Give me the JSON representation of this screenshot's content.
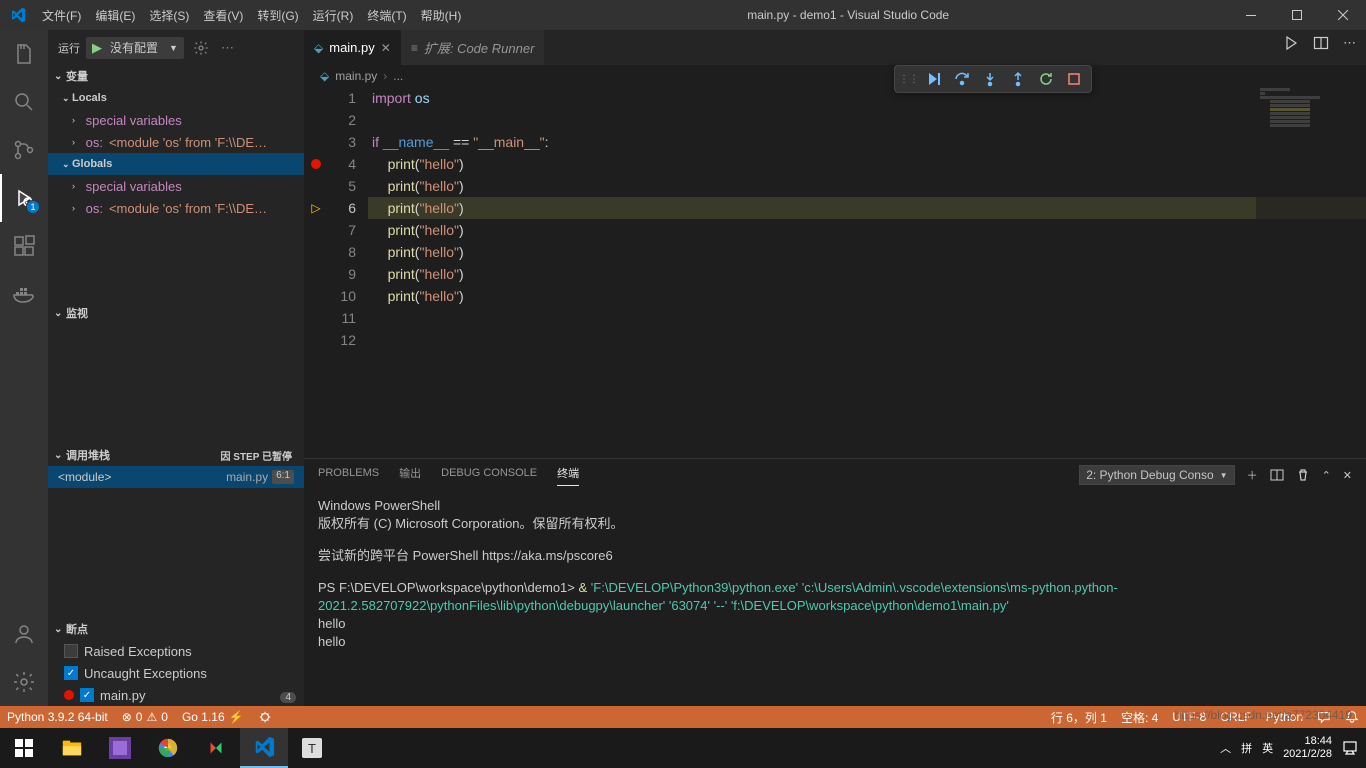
{
  "titlebar": {
    "menus": [
      "文件(F)",
      "编辑(E)",
      "选择(S)",
      "查看(V)",
      "转到(G)",
      "运行(R)",
      "终端(T)",
      "帮助(H)"
    ],
    "title": "main.py - demo1 - Visual Studio Code"
  },
  "debug": {
    "run_label": "运行",
    "config": "没有配置",
    "sections": {
      "vars": "变量",
      "locals": "Locals",
      "globals": "Globals",
      "watch": "监视",
      "callstack": "调用堆栈",
      "paused": "因 STEP 已暂停",
      "breakpoints": "断点"
    },
    "special": "special variables",
    "os_label": "os:",
    "os_val": "<module 'os' from 'F:\\\\DE…",
    "cs_module": "<module>",
    "cs_file": "main.py",
    "cs_line": "6:1",
    "bp_raised": "Raised Exceptions",
    "bp_uncaught": "Uncaught Exceptions",
    "bp_main": "main.py",
    "bp_main_n": "4"
  },
  "tabs": {
    "main": "main.py",
    "ext": "扩展: Code Runner"
  },
  "crumb": {
    "file": "main.py",
    "more": "..."
  },
  "code": {
    "lines": [
      {
        "n": 1,
        "seg": [
          {
            "t": "import",
            "c": "k1"
          },
          {
            "t": " ",
            "c": "p"
          },
          {
            "t": "os",
            "c": "v"
          }
        ]
      },
      {
        "n": 2,
        "seg": []
      },
      {
        "n": 3,
        "seg": [
          {
            "t": "if",
            "c": "k1"
          },
          {
            "t": " ",
            "c": "p"
          },
          {
            "t": "__name__",
            "c": "k2"
          },
          {
            "t": " == ",
            "c": "p"
          },
          {
            "t": "\"__main__\"",
            "c": "s"
          },
          {
            "t": ":",
            "c": "p"
          }
        ]
      },
      {
        "n": 4,
        "seg": [
          {
            "t": "    ",
            "c": "p"
          },
          {
            "t": "print",
            "c": "fn"
          },
          {
            "t": "(",
            "c": "p"
          },
          {
            "t": "\"hello\"",
            "c": "s"
          },
          {
            "t": ")",
            "c": "p"
          }
        ],
        "bp": true
      },
      {
        "n": 5,
        "seg": [
          {
            "t": "    ",
            "c": "p"
          },
          {
            "t": "print",
            "c": "fn"
          },
          {
            "t": "(",
            "c": "p"
          },
          {
            "t": "\"hello\"",
            "c": "s"
          },
          {
            "t": ")",
            "c": "p"
          }
        ]
      },
      {
        "n": 6,
        "seg": [
          {
            "t": "    ",
            "c": "p"
          },
          {
            "t": "print",
            "c": "fn"
          },
          {
            "t": "(",
            "c": "p"
          },
          {
            "t": "\"hello\"",
            "c": "s"
          },
          {
            "t": ")",
            "c": "p"
          }
        ],
        "hl": true,
        "arrow": true
      },
      {
        "n": 7,
        "seg": [
          {
            "t": "    ",
            "c": "p"
          },
          {
            "t": "print",
            "c": "fn"
          },
          {
            "t": "(",
            "c": "p"
          },
          {
            "t": "\"hello\"",
            "c": "s"
          },
          {
            "t": ")",
            "c": "p"
          }
        ]
      },
      {
        "n": 8,
        "seg": [
          {
            "t": "    ",
            "c": "p"
          },
          {
            "t": "print",
            "c": "fn"
          },
          {
            "t": "(",
            "c": "p"
          },
          {
            "t": "\"hello\"",
            "c": "s"
          },
          {
            "t": ")",
            "c": "p"
          }
        ]
      },
      {
        "n": 9,
        "seg": [
          {
            "t": "    ",
            "c": "p"
          },
          {
            "t": "print",
            "c": "fn"
          },
          {
            "t": "(",
            "c": "p"
          },
          {
            "t": "\"hello\"",
            "c": "s"
          },
          {
            "t": ")",
            "c": "p"
          }
        ]
      },
      {
        "n": 10,
        "seg": [
          {
            "t": "    ",
            "c": "p"
          },
          {
            "t": "print",
            "c": "fn"
          },
          {
            "t": "(",
            "c": "p"
          },
          {
            "t": "\"hello\"",
            "c": "s"
          },
          {
            "t": ")",
            "c": "p"
          }
        ]
      },
      {
        "n": 11,
        "seg": []
      },
      {
        "n": 12,
        "seg": []
      }
    ]
  },
  "panel": {
    "tabs": {
      "problems": "PROBLEMS",
      "output": "输出",
      "debug": "DEBUG CONSOLE",
      "terminal": "终端"
    },
    "dd": "2: Python Debug Conso",
    "term": {
      "l1": "Windows PowerShell",
      "l2": "版权所有 (C) Microsoft Corporation。保留所有权利。",
      "l3": "尝试新的跨平台 PowerShell https://aka.ms/pscore6",
      "l4a": "PS F:\\DEVELOP\\workspace\\python\\demo1> ",
      "l4b": " & ",
      "l4c": "'F:\\DEVELOP\\Python39\\python.exe' 'c:\\Users\\Admin\\.vscode\\extensions\\ms-python.python-2021.2.582707922\\pythonFiles\\lib\\python\\debugpy\\launcher' '63074' '--' 'f:\\DEVELOP\\workspace\\python\\demo1\\main.py'",
      "l5": "hello",
      "l6": "hello"
    }
  },
  "status": {
    "python": "Python 3.9.2 64-bit",
    "err": "0",
    "warn": "0",
    "go": "Go 1.16",
    "ln": "行 6，列 1",
    "spaces": "空格: 4",
    "enc": "UTF-8",
    "eol": "CRLF",
    "lang": "Python"
  },
  "tray": {
    "ime1": "拼",
    "ime2": "英",
    "time": "18:44",
    "date": "2021/2/28"
  },
  "watermark": "https://blog.csdn.net/a772304419"
}
